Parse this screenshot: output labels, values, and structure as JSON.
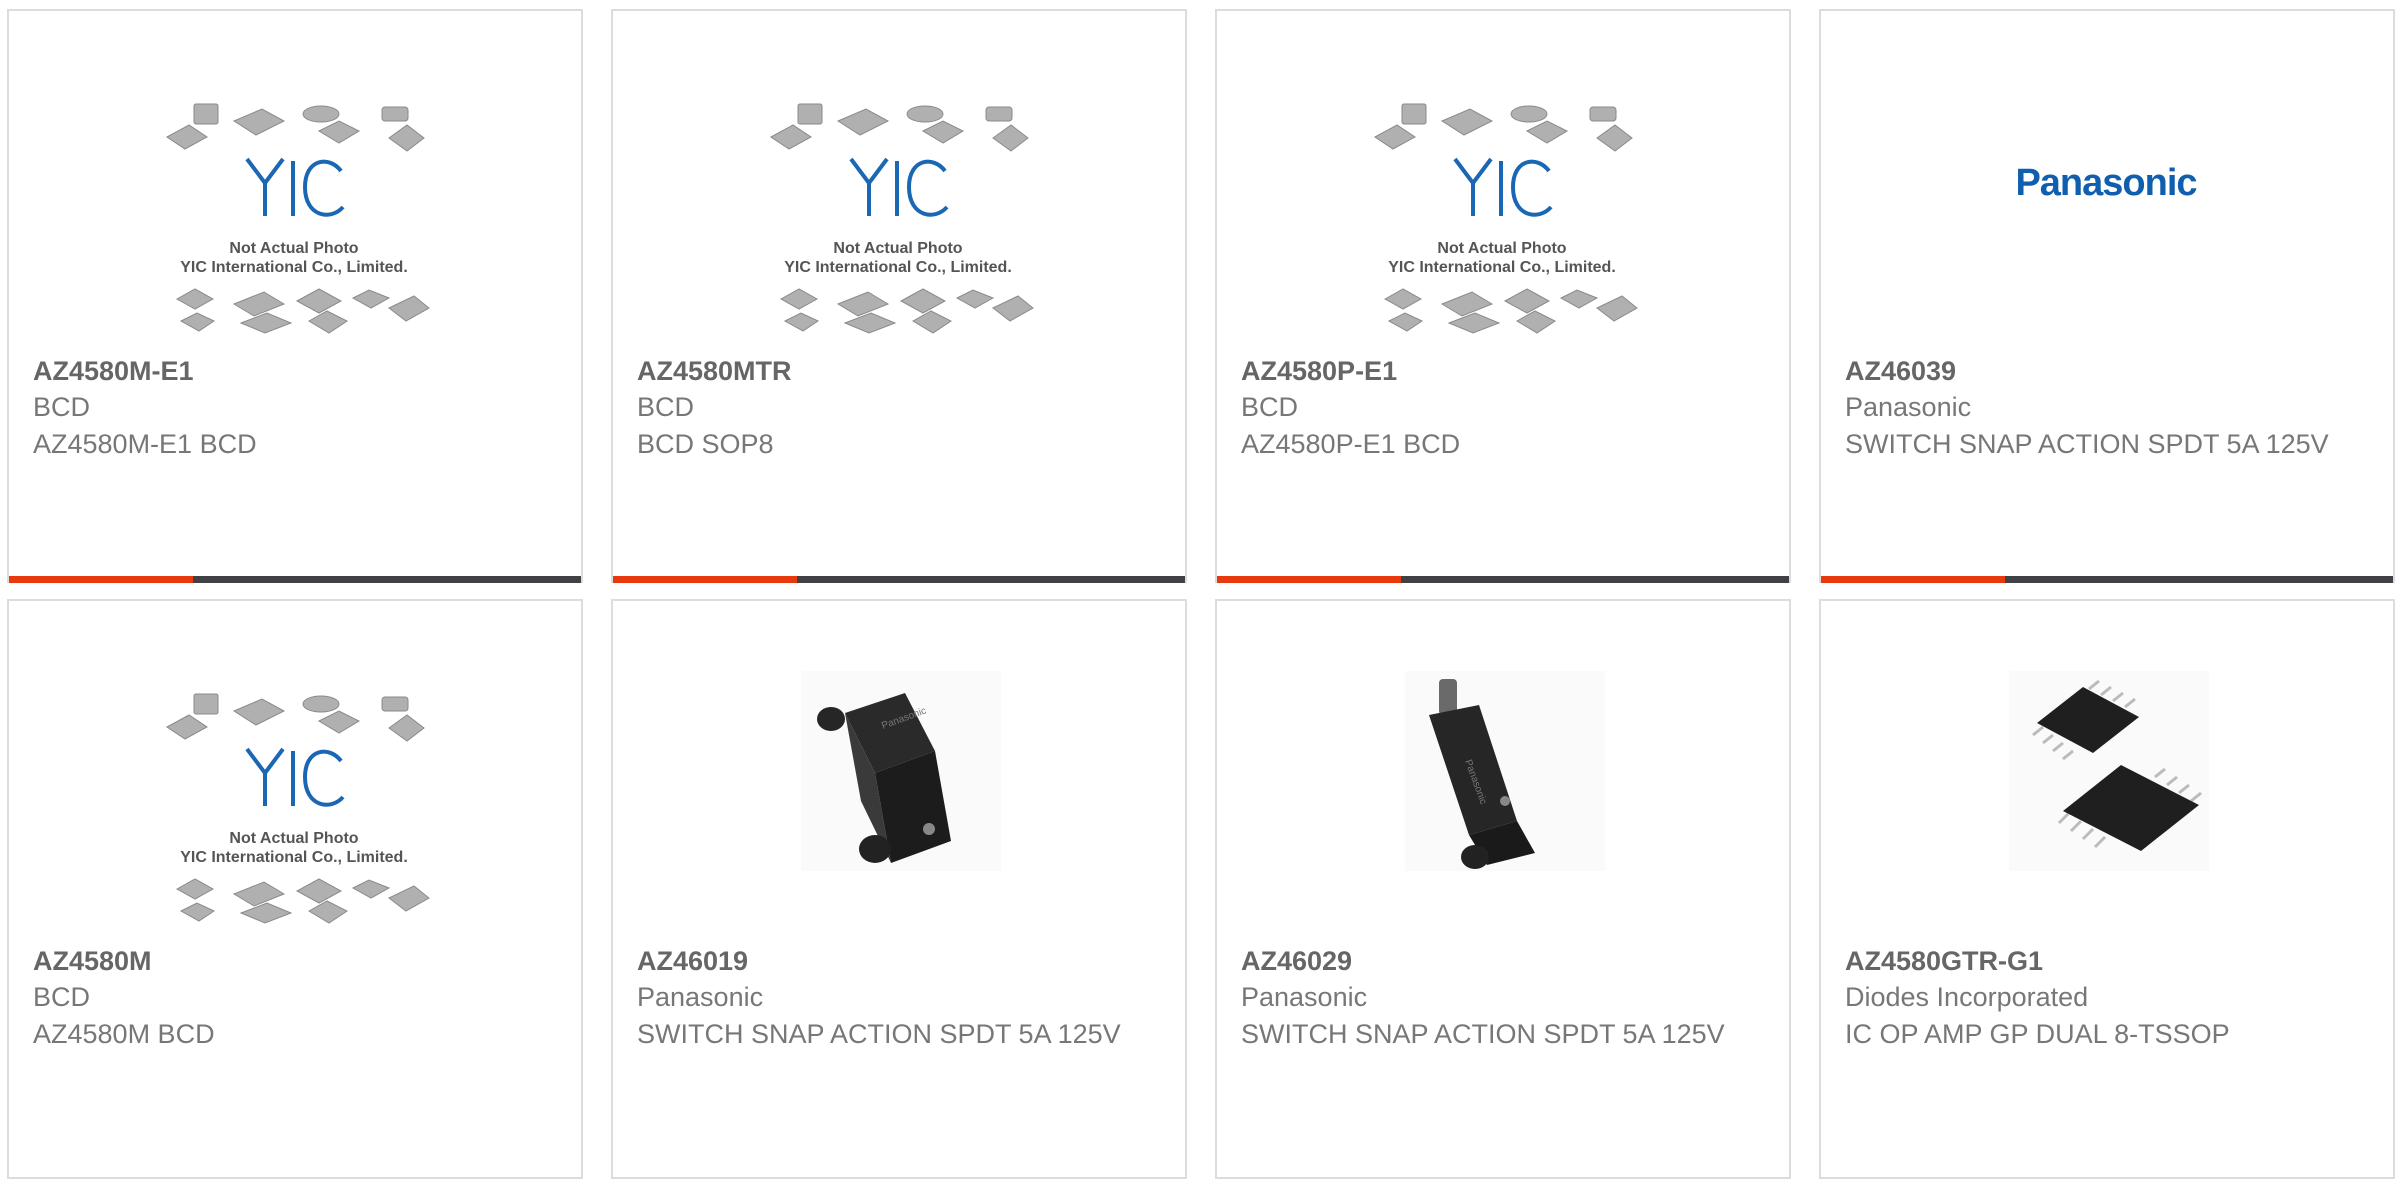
{
  "products": [
    {
      "part_number": "AZ4580M-E1",
      "manufacturer": "BCD",
      "description": "AZ4580M-E1 BCD",
      "image": "yic-not-actual-photo",
      "image_caption_1": "Not Actual Photo",
      "image_caption_2": "YIC International Co., Limited."
    },
    {
      "part_number": "AZ4580MTR",
      "manufacturer": "BCD",
      "description": "BCD SOP8",
      "image": "yic-not-actual-photo",
      "image_caption_1": "Not Actual Photo",
      "image_caption_2": "YIC International Co., Limited."
    },
    {
      "part_number": "AZ4580P-E1",
      "manufacturer": "BCD",
      "description": "AZ4580P-E1 BCD",
      "image": "yic-not-actual-photo",
      "image_caption_1": "Not Actual Photo",
      "image_caption_2": "YIC International Co., Limited."
    },
    {
      "part_number": "AZ46039",
      "manufacturer": "Panasonic",
      "description": "SWITCH SNAP ACTION SPDT 5A 125V",
      "image": "panasonic-logo",
      "logo_text": "Panasonic"
    },
    {
      "part_number": "AZ4580M",
      "manufacturer": "BCD",
      "description": "AZ4580M BCD",
      "image": "yic-not-actual-photo",
      "image_caption_1": "Not Actual Photo",
      "image_caption_2": "YIC International Co., Limited."
    },
    {
      "part_number": "AZ46019",
      "manufacturer": "Panasonic",
      "description": "SWITCH SNAP ACTION SPDT 5A 125V",
      "image": "snap-switch-photo"
    },
    {
      "part_number": "AZ46029",
      "manufacturer": "Panasonic",
      "description": "SWITCH SNAP ACTION SPDT 5A 125V",
      "image": "snap-switch-plunger-photo"
    },
    {
      "part_number": "AZ4580GTR-G1",
      "manufacturer": "Diodes Incorporated",
      "description": "IC OP AMP GP DUAL 8-TSSOP",
      "image": "tssop-ic-photo"
    }
  ],
  "colors": {
    "accent": "#e8380d",
    "bar": "#3f4144",
    "border": "#dcdcdc",
    "panasonic_blue": "#0f5fae"
  }
}
